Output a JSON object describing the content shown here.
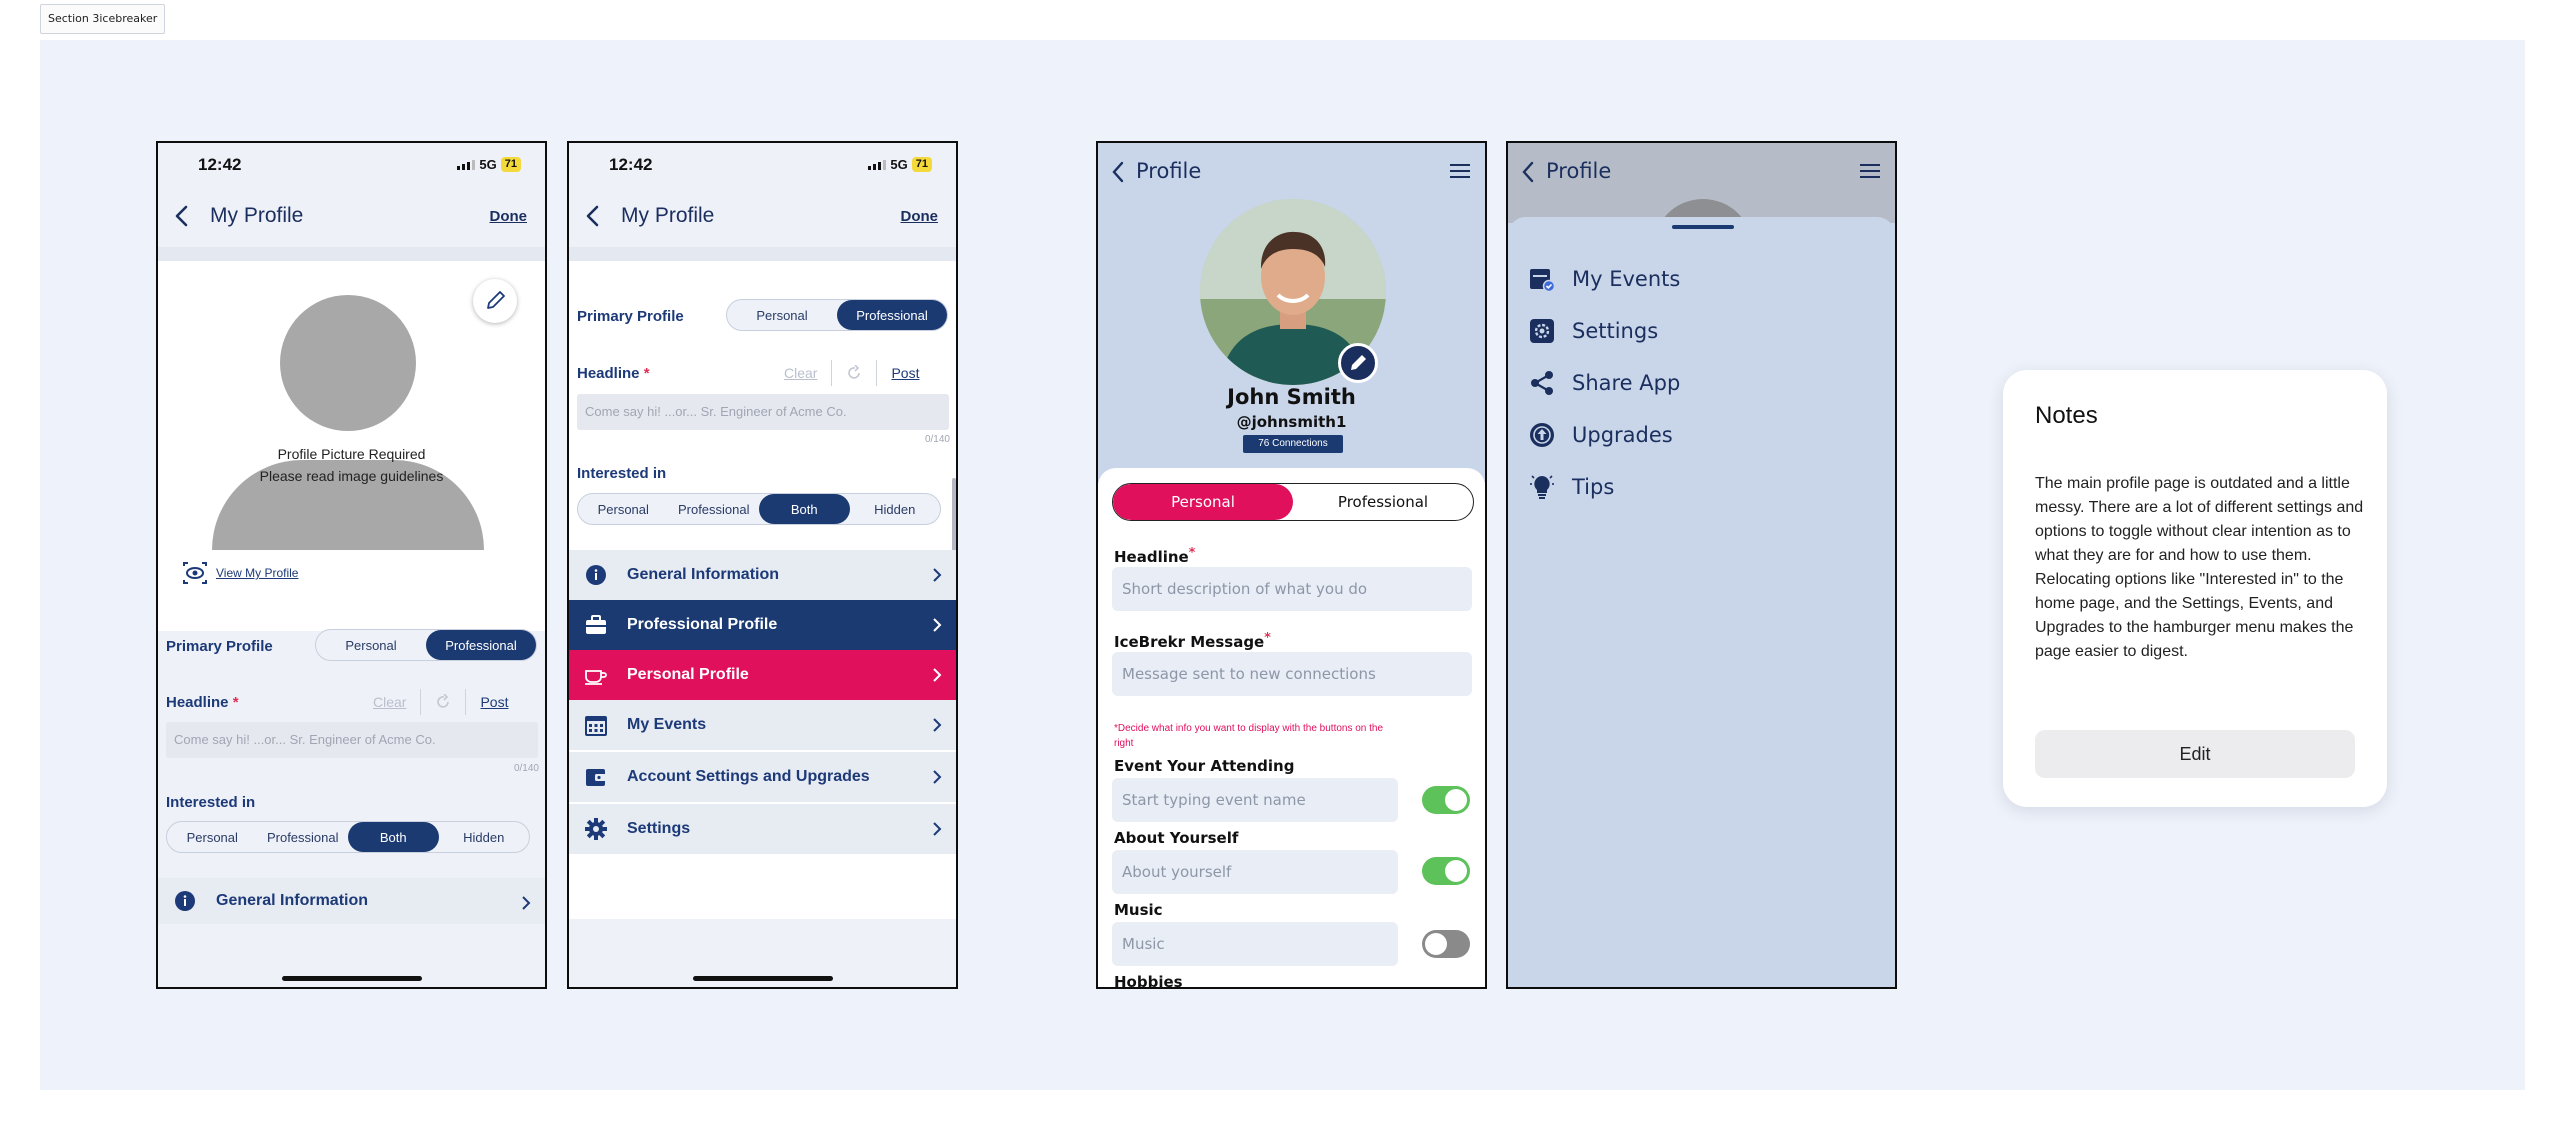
{
  "section_label": "Section 3icebreaker",
  "status": {
    "time": "12:42",
    "network": "5G",
    "battery": "71"
  },
  "screen1": {
    "title": "My Profile",
    "done": "Done",
    "pic_required": "Profile Picture Required",
    "pic_guidelines": "Please read image guidelines",
    "view_profile": "View My Profile",
    "primary_profile": "Primary Profile",
    "seg_personal": "Personal",
    "seg_professional": "Professional",
    "headline": "Headline",
    "req_star": "*",
    "clear": "Clear",
    "post": "Post",
    "headline_placeholder": "Come say hi!  ...or...  Sr. Engineer of Acme Co.",
    "char_count": "0/140",
    "interested_in": "Interested in",
    "interest_options": [
      "Personal",
      "Professional",
      "Both",
      "Hidden"
    ],
    "general_info": "General Information"
  },
  "screen2": {
    "title": "My Profile",
    "done": "Done",
    "primary_profile": "Primary Profile",
    "seg_personal": "Personal",
    "seg_professional": "Professional",
    "headline": "Headline",
    "req_star": "*",
    "clear": "Clear",
    "post": "Post",
    "headline_placeholder": "Come say hi!  ...or...  Sr. Engineer of Acme Co.",
    "char_count": "0/140",
    "interested_in": "Interested in",
    "interest_options": [
      "Personal",
      "Professional",
      "Both",
      "Hidden"
    ],
    "menu": [
      "General Information",
      "Professional Profile",
      "Personal Profile",
      "My Events",
      "Account Settings and Upgrades",
      "Settings"
    ]
  },
  "screen3": {
    "title": "Profile",
    "name": "John Smith",
    "handle": "@johnsmith1",
    "connections": "76 Connections",
    "tab_personal": "Personal",
    "tab_professional": "Professional",
    "headline": "Headline",
    "headline_placeholder": "Short description of what you do",
    "icebrekr_message": "IceBrekr Message",
    "icebrekr_placeholder": "Message sent to new connections",
    "note": "*Decide what info you want to display with the buttons on the right",
    "event_label": "Event Your Attending",
    "event_placeholder": "Start typing event name",
    "about_label": "About Yourself",
    "about_placeholder": "About yourself",
    "music_label": "Music",
    "music_placeholder": "Music",
    "hobbies_label": "Hobbies",
    "toggles": {
      "event": true,
      "about": true,
      "music": false
    }
  },
  "screen4": {
    "title": "Profile",
    "drawer_items": [
      "My Events",
      "Settings",
      "Share App",
      "Upgrades",
      "Tips"
    ]
  },
  "notes": {
    "title": "Notes",
    "body": "The main profile page is outdated and a little messy. There are a lot of different settings and options to toggle without clear intention as to what they are for and how to use them. Relocating options like \"Interested in\" to the home page, and the Settings, Events, and Upgrades to the hamburger menu makes the page easier to digest.",
    "edit": "Edit"
  },
  "colors": {
    "navy": "#1b3a72",
    "pink": "#e0105d",
    "toggle_on": "#5ec25a",
    "canvas": "#eef2fa"
  }
}
